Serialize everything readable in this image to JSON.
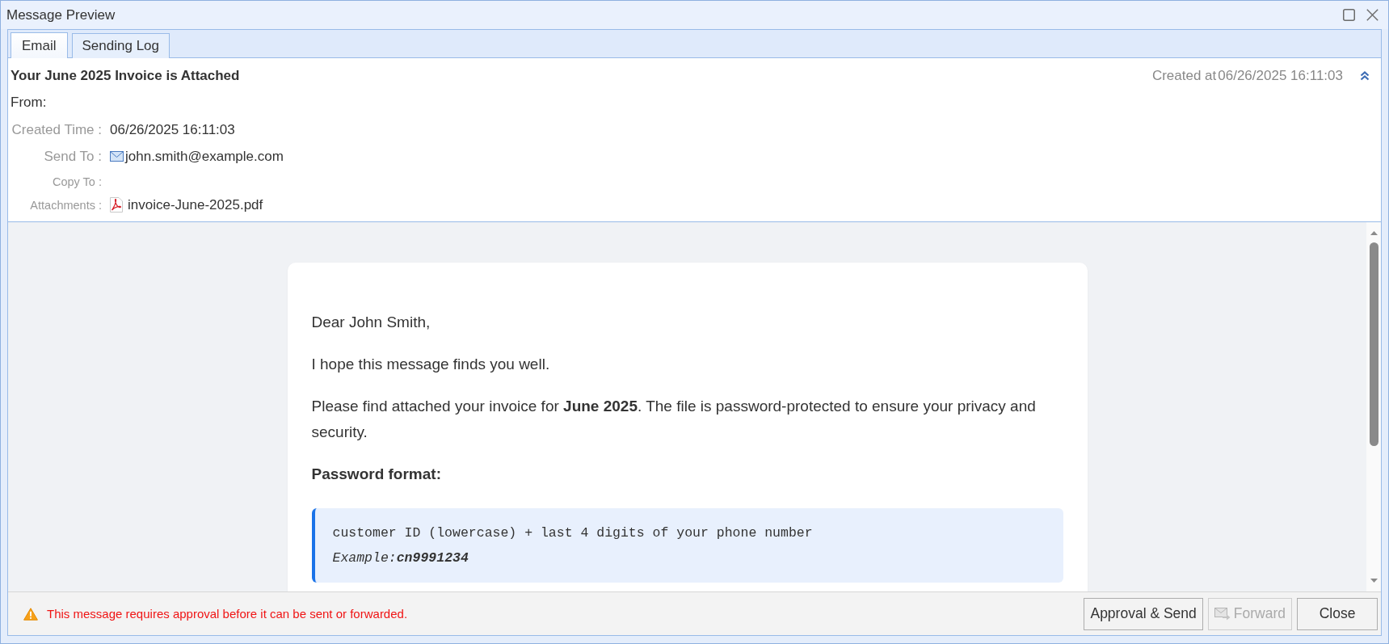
{
  "window": {
    "title": "Message Preview"
  },
  "tabs": [
    {
      "label": "Email",
      "selected": true
    },
    {
      "label": "Sending Log",
      "selected": false
    }
  ],
  "header": {
    "subject": "Your June 2025 Invoice is Attached",
    "created_at": {
      "label": "Created at",
      "value": "06/26/2025 16:11:03"
    },
    "expanded": true,
    "from": {
      "label": "From:"
    },
    "fields": [
      {
        "kind": "text",
        "label": "Created Time :",
        "value": "06/26/2025 16:11:03"
      },
      {
        "kind": "email",
        "label": "Send To :",
        "value": "john.smith@example.com"
      },
      {
        "kind": "text",
        "label": "Copy To :"
      },
      {
        "kind": "attachment",
        "label": "Attachments :",
        "value": "invoice-June-2025.pdf"
      }
    ]
  },
  "message": {
    "paragraphs": [
      {
        "kind": "text",
        "text": "Dear John Smith,"
      },
      {
        "kind": "text",
        "text": "I hope this message finds you well."
      },
      {
        "kind": "text",
        "text": "Please find attached your invoice for **June 2025**. The file is password-protected to ensure your privacy and security."
      },
      {
        "kind": "heading",
        "text": "Password format:"
      },
      {
        "kind": "code",
        "lines": [
          {
            "kind": "plain",
            "text": "customer ID (lowercase) + last 4 digits of your phone number"
          },
          {
            "kind": "example",
            "text": "Example:**cn9991234**"
          }
        ]
      }
    ]
  },
  "footer": {
    "warning": "This message requires approval before it can be sent or forwarded.",
    "buttons": [
      {
        "kind": "plain",
        "label": "Approval & Send",
        "disabled": false
      },
      {
        "kind": "forward",
        "label": "Forward",
        "disabled": true
      },
      {
        "kind": "plain",
        "label": "Close",
        "disabled": false
      }
    ]
  }
}
